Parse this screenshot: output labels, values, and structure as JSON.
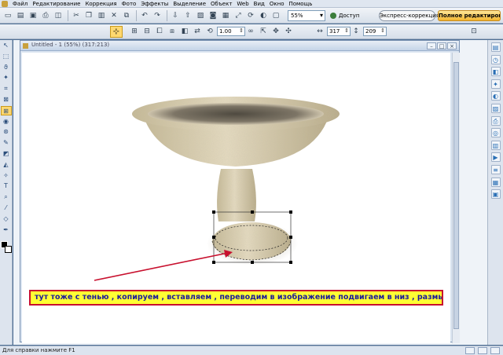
{
  "menu": {
    "items": [
      "Файл",
      "Редактирование",
      "Коррекция",
      "Фото",
      "Эффекты",
      "Выделение",
      "Объект",
      "Web",
      "Вид",
      "Окно",
      "Помощь"
    ]
  },
  "toolbar": {
    "zoom_value": "55%",
    "access_label": "Доступ",
    "express_tab": "Экспресс-коррекция",
    "full_tab": "Полное редактиров..."
  },
  "options": {
    "scale_value": "1.00",
    "width_value": "317",
    "height_value": "209"
  },
  "document": {
    "title": "Untitled - 1 (55%) (317:213)"
  },
  "annotation": {
    "text": "тут тоже с тенью , копируем , вставляем , переводим в изображение подвигаем в низ , размываем ."
  },
  "status": {
    "text": "Для справки нажмите F1"
  },
  "colors": {
    "annotation_bg": "#ffff33",
    "annotation_border": "#c8102e",
    "annotation_text": "#1a1a9a",
    "arrow": "#c8102e",
    "active_tab": "#f3b52f"
  },
  "icons": {
    "left_tools": [
      "pointer-icon",
      "selection-icon",
      "lasso-icon",
      "magic-wand-icon",
      "crop-icon",
      "transform-icon",
      "straighten-icon",
      "red-eye-icon",
      "clone-icon",
      "brush-icon",
      "eraser-icon",
      "fill-icon",
      "retouch-icon",
      "text-icon",
      "zoom-icon",
      "eyedropper-icon",
      "shape-icon",
      "pen-icon"
    ],
    "right_panel": [
      "layers-icon",
      "history-icon",
      "objects-icon",
      "effects-icon",
      "color-icon",
      "image-icon",
      "print-icon",
      "web-icon",
      "library-icon",
      "adjust-icon",
      "options-icon",
      "layout-icon",
      "info-icon"
    ]
  }
}
